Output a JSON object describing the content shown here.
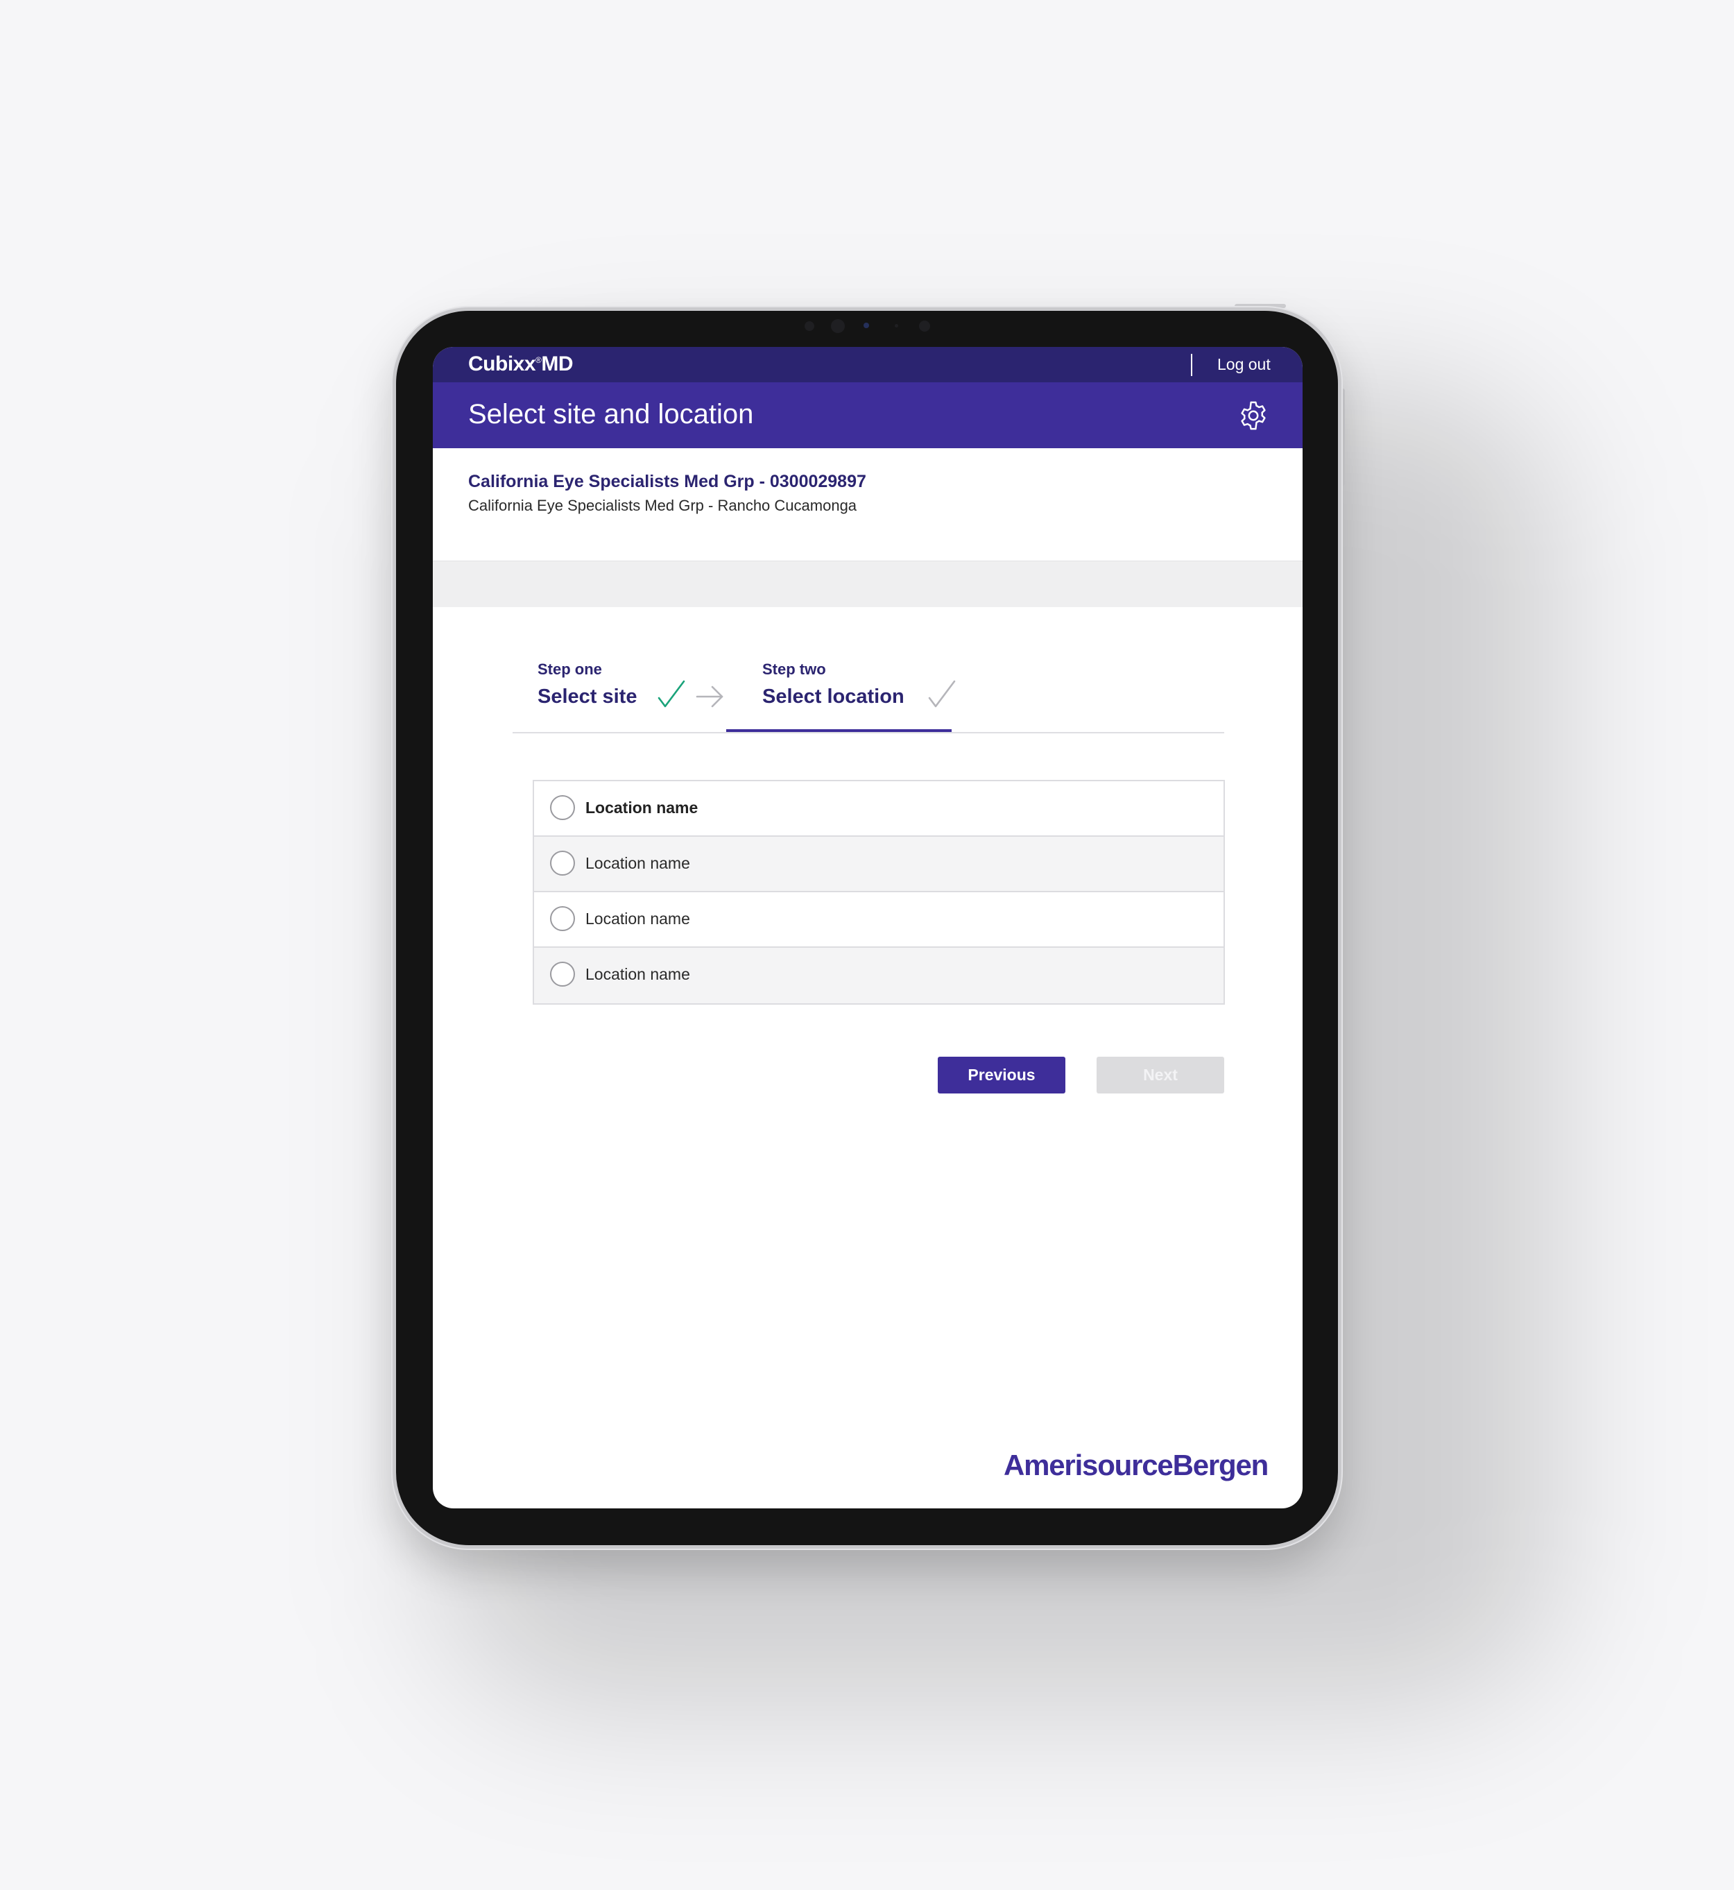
{
  "app": {
    "brand_name": "Cubixx",
    "brand_reg": "®",
    "brand_suffix": "MD",
    "logout_label": "Log out"
  },
  "header": {
    "title": "Select site and location"
  },
  "organization": {
    "name": "California Eye Specialists Med Grp - 0300029897",
    "subtitle": "California Eye Specialists Med Grp - Rancho Cucamonga"
  },
  "stepper": {
    "steps": [
      {
        "label": "Step one",
        "title": "Select site",
        "status": "complete"
      },
      {
        "label": "Step two",
        "title": "Select location",
        "status": "active"
      }
    ]
  },
  "locations": {
    "items": [
      {
        "label": "Location name",
        "selected": false
      },
      {
        "label": "Location  name",
        "selected": false
      },
      {
        "label": "Location  name",
        "selected": false
      },
      {
        "label": "Location  name",
        "selected": false
      }
    ]
  },
  "actions": {
    "previous_label": "Previous",
    "next_label": "Next",
    "next_enabled": false
  },
  "footer": {
    "logo_text": "AmerisourceBergen"
  },
  "colors": {
    "topbar": "#2b2470",
    "titlebar": "#3e2e9a",
    "accent": "#3e2e9a",
    "success_check": "#1aa37a",
    "pending_check": "#b5b5ba"
  },
  "icons": {
    "settings": "gear-icon",
    "step_complete": "check-icon",
    "step_pending": "check-icon",
    "step_arrow": "arrow-right-icon"
  }
}
